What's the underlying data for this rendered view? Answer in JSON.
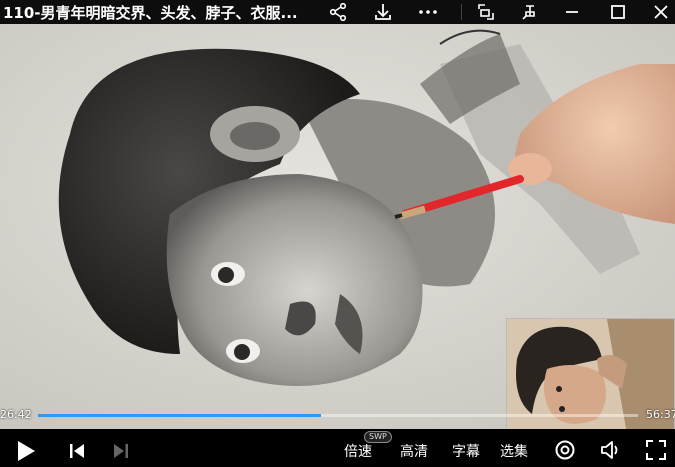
{
  "window": {
    "title": "110-男青年明暗交界、头发、脖子、衣服...",
    "icons": [
      "share-icon",
      "download-icon",
      "more-icon",
      "pip-icon",
      "pin-icon",
      "minimize-icon",
      "maximize-icon",
      "close-icon"
    ]
  },
  "player": {
    "current_time": "26:42",
    "total_time": "56:37",
    "progress": 0.471,
    "speed_label": "倍速",
    "speed_badge": "SWP",
    "quality_label": "高清",
    "subtitle_label": "字幕",
    "episodes_label": "选集",
    "accent_color": "#2f9bf0"
  }
}
